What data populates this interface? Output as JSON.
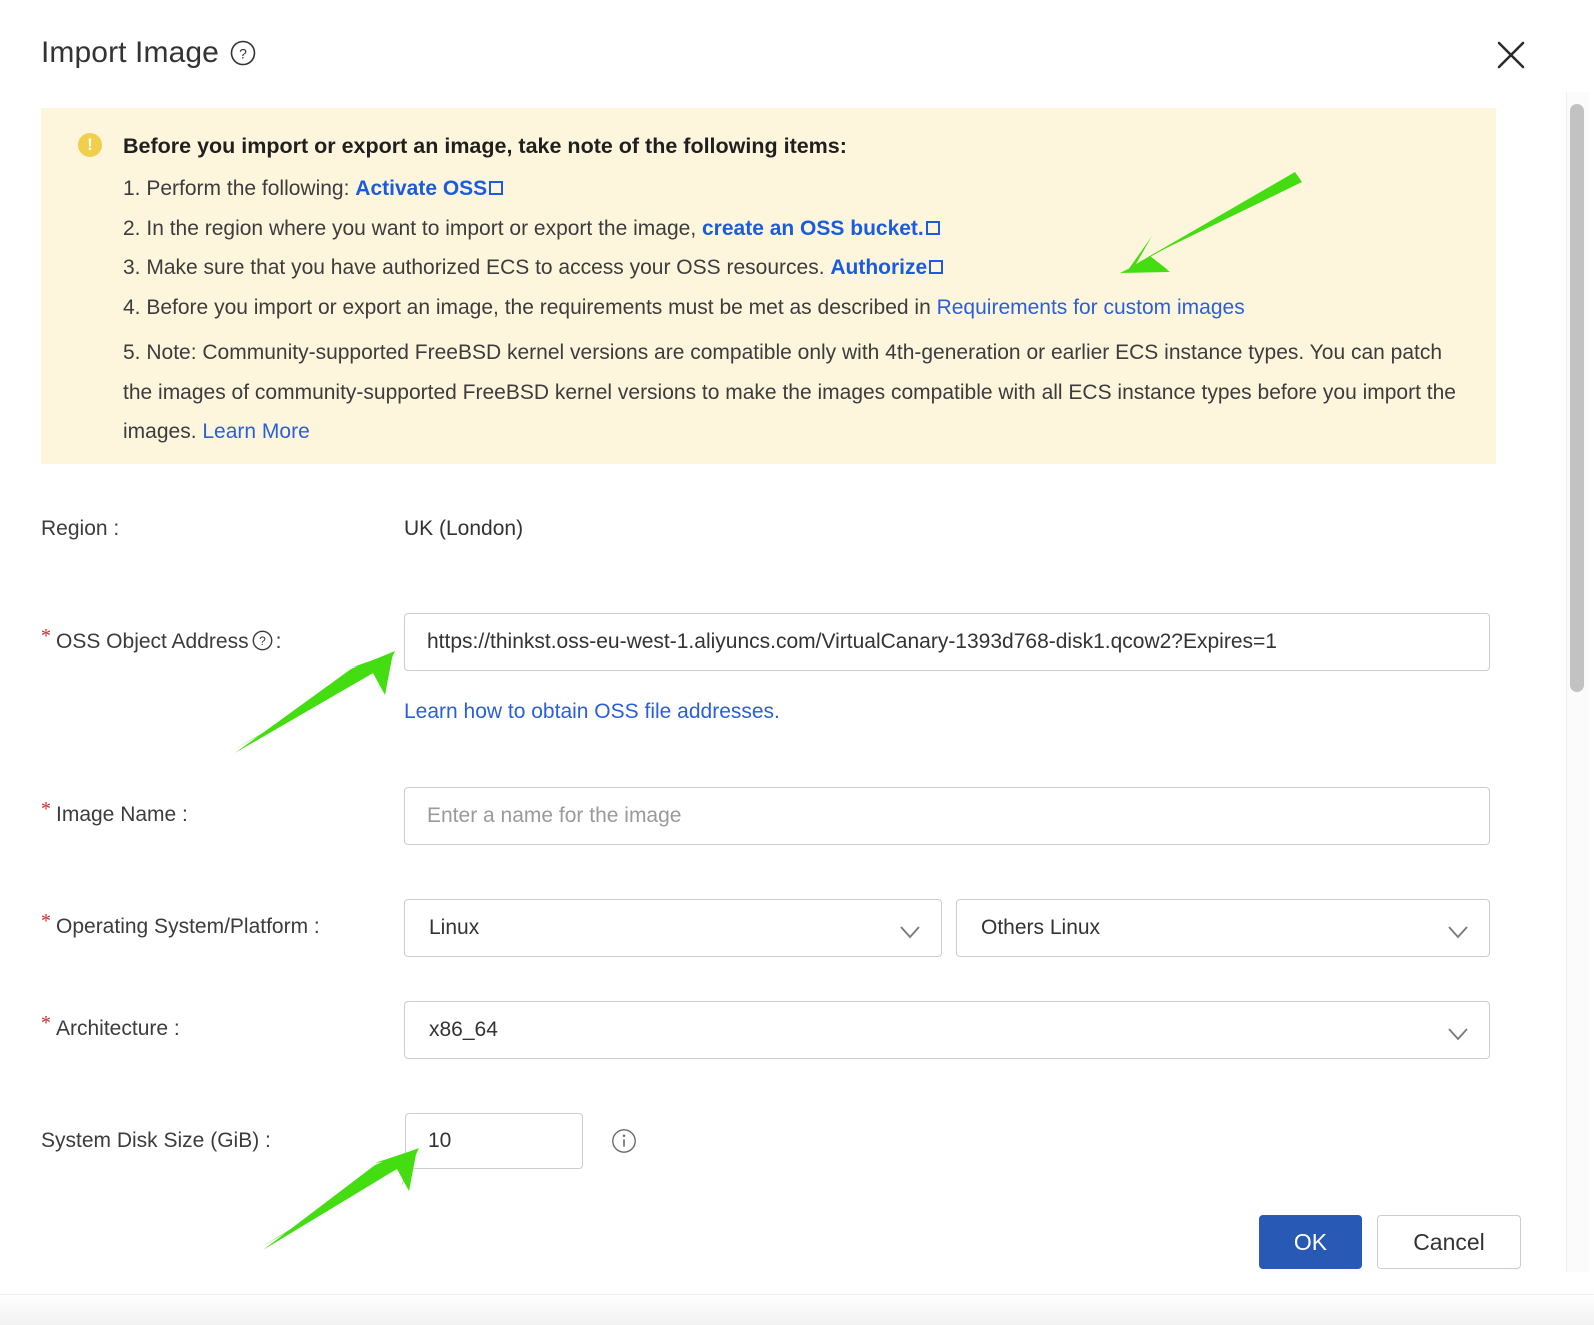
{
  "dialog": {
    "title": "Import Image",
    "help_icon": "question-circle-icon",
    "close_icon": "close-icon"
  },
  "notice": {
    "icon": "warning-icon",
    "title": "Before you import or export an image, take note of the following items:",
    "items": [
      {
        "num": "1.",
        "text_before": "Perform the following: ",
        "link": "Activate OSS",
        "link_external": true,
        "text_after": ""
      },
      {
        "num": "2.",
        "text_before": "In the region where you want to import or export the image, ",
        "link": "create an OSS bucket.",
        "link_external": true,
        "text_after": ""
      },
      {
        "num": "3.",
        "text_before": "Make sure that you have authorized ECS to access your OSS resources.  ",
        "link": "Authorize",
        "link_external": true,
        "text_after": ""
      },
      {
        "num": "4.",
        "text_before": "Before you import or export an image, the requirements must be met as described in ",
        "link": "Requirements for custom images",
        "link_external": false,
        "text_after": ""
      }
    ],
    "note_num": "5.",
    "note_text": "Note: Community-supported FreeBSD kernel versions are compatible only with 4th-generation or earlier ECS instance types. You can patch the images of community-supported FreeBSD kernel versions to make the images compatible with all ECS instance types before you import the images. ",
    "note_link": "Learn More",
    "bg_color": "#fdf6dd",
    "link_color": "#2b5fd9"
  },
  "form": {
    "region": {
      "label": "Region :",
      "value": "UK (London)"
    },
    "oss_object_address": {
      "label": "OSS Object Address",
      "label_suffix": ":",
      "required": true,
      "help_icon": "question-circle-icon",
      "value": "https://thinkst.oss-eu-west-1.aliyuncs.com/VirtualCanary-1393d768-disk1.qcow2?Expires=1",
      "placeholder": "",
      "helper_link": "Learn how to obtain OSS file addresses."
    },
    "image_name": {
      "label": "Image Name :",
      "required": true,
      "value": "",
      "placeholder": "Enter a name for the image"
    },
    "os_platform": {
      "label": "Operating System/Platform :",
      "required": true,
      "os_value": "Linux",
      "platform_value": "Others Linux",
      "caret_icon": "chevron-down-icon"
    },
    "architecture": {
      "label": "Architecture :",
      "required": true,
      "value": "x86_64",
      "caret_icon": "chevron-down-icon"
    },
    "system_disk_size": {
      "label": "System Disk Size (GiB) :",
      "required": false,
      "value": "10",
      "info_icon": "info-circle-icon"
    }
  },
  "footer": {
    "ok_label": "OK",
    "cancel_label": "Cancel",
    "primary_color": "#2759b5"
  },
  "annotations": {
    "arrow_color": "#44dd11",
    "arrows": [
      {
        "name": "arrow-to-authorize-link"
      },
      {
        "name": "arrow-to-oss-object-address-input"
      },
      {
        "name": "arrow-to-system-disk-size-input"
      }
    ]
  }
}
